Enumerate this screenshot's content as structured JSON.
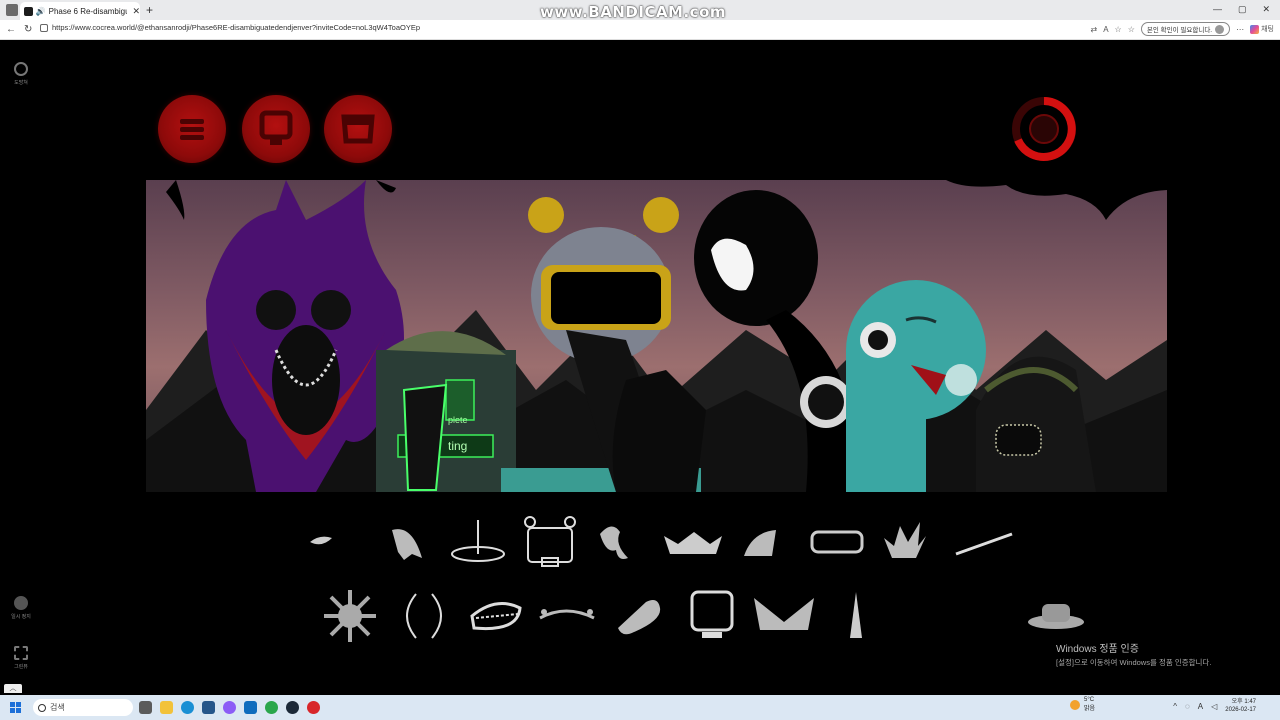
{
  "browser": {
    "tab_title": "Phase 6 Re-disambiguated (n",
    "tab_close": "✕",
    "new_tab": "+",
    "url": "https://www.cocrea.world/@ethansanrodji/Phase6RE-disambiguatedendjenver?inviteCode=noL3qW4ToaOYEp",
    "profile_pill": "본인 확인이 필요합니다.",
    "copilot_label": "채팅",
    "window_min": "—",
    "window_max": "▢",
    "window_close": "✕"
  },
  "recorder_watermark": "www.BANDICAM.com",
  "sidebar": {
    "items": [
      {
        "label": "도망쳐",
        "icon": "refresh-icon"
      },
      {
        "label": "일시 정지",
        "icon": "pause-icon"
      },
      {
        "label": "그린뷰",
        "icon": "fullscreen-icon"
      }
    ]
  },
  "game": {
    "colors": {
      "accent": "#b31010",
      "scene_sky": "#7f5a63",
      "purple": "#5a1880",
      "teal": "#3aa7a3",
      "yellow": "#c9a318"
    },
    "top_buttons": [
      {
        "icon": "menu-icon"
      },
      {
        "icon": "character-icon"
      },
      {
        "icon": "bucket-icon"
      }
    ],
    "timer_icon": "record-timer-icon",
    "scene_text": {
      "complete": "plete",
      "waiting": "ting"
    },
    "palette_row1": [
      "tear-icon",
      "claw-icon",
      "antenna-disc-icon",
      "box-antenna-icon",
      "swirl-icon",
      "crown-icon",
      "wing-icon",
      "visor-icon",
      "spiky-crown-icon",
      "stick-icon"
    ],
    "palette_row2": [
      "sun-icon",
      "brackets-icon",
      "teeth-icon",
      "brow-icon",
      "bone-icon",
      "monitor-icon",
      "shirt-collar-icon",
      "tower-icon",
      "",
      "hat-icon"
    ]
  },
  "windows_activation": {
    "title": "Windows 정품 인증",
    "subtitle": "[설정]으로 이동하여 Windows를 정품 인증합니다."
  },
  "taskbar": {
    "search_label": "검색",
    "weather_temp": "5°C",
    "weather_desc": "맑음",
    "time": "오후 1:47",
    "date": "2026-02-17"
  }
}
